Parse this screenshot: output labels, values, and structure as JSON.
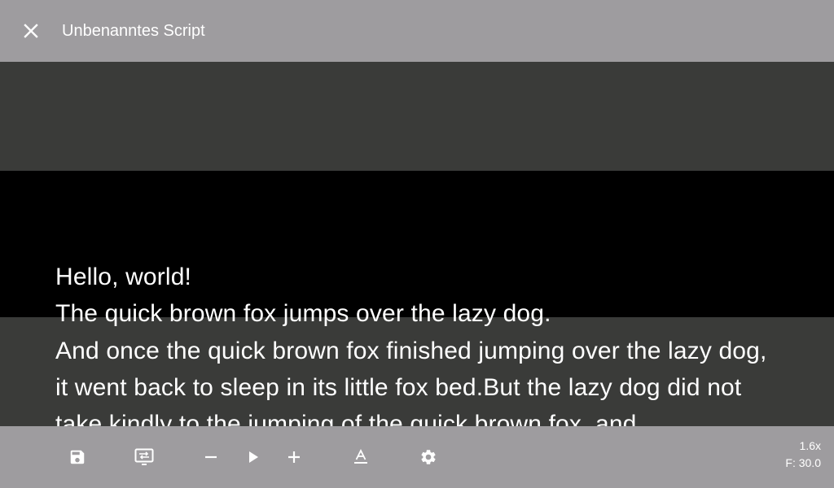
{
  "header": {
    "title": "Unbenanntes Script",
    "close_icon": "close-icon"
  },
  "script": {
    "lines": [
      "Hello, world!",
      "The quick brown fox jumps over the lazy dog.",
      "And once the quick brown fox finished jumping over the lazy dog, it went back to sleep in its little fox bed.But the lazy dog did not take kindly to the jumping of the quick brown fox, and"
    ]
  },
  "toolbar": {
    "icons": [
      "save-icon",
      "presentation-icon",
      "minus-icon",
      "play-icon",
      "plus-icon",
      "text-format-icon",
      "gear-icon"
    ]
  },
  "status": {
    "speed": "1.6x",
    "font_size": "F: 30.0"
  },
  "colors": {
    "bar": "#9e9c9f",
    "band": "#3a3b39",
    "reading": "#000000",
    "text": "#ffffff"
  }
}
